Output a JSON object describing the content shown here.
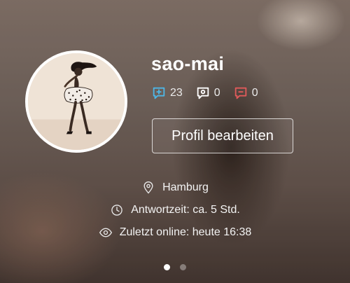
{
  "profile": {
    "username": "sao-mai",
    "stats": {
      "positive": {
        "icon": "comment-plus-icon",
        "count": "23",
        "color": "#4db6e6"
      },
      "neutral": {
        "icon": "comment-neutral-icon",
        "count": "0",
        "color": "#ffffff"
      },
      "negative": {
        "icon": "comment-minus-icon",
        "count": "0",
        "color": "#e05a5a"
      }
    },
    "edit_button_label": "Profil bearbeiten",
    "location": {
      "icon": "location-pin-icon",
      "text": "Hamburg"
    },
    "response_time": {
      "icon": "clock-icon",
      "text": "Antwortzeit: ca. 5 Std."
    },
    "last_online": {
      "icon": "eye-icon",
      "text": "Zuletzt online: heute 16:38"
    }
  },
  "pager": {
    "total": 2,
    "active_index": 0
  }
}
